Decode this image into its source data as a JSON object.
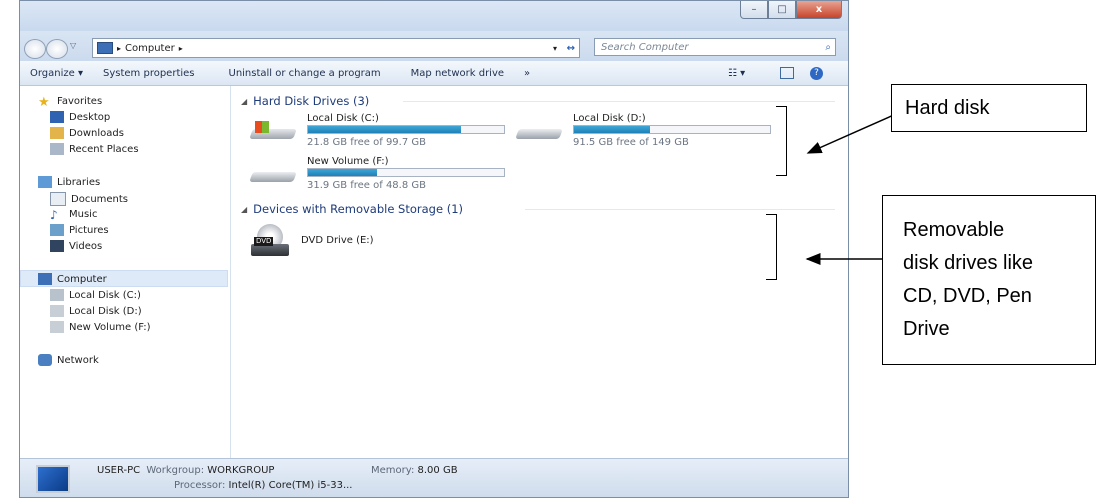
{
  "window": {
    "minimize": "–",
    "maximize": "□",
    "close": "x"
  },
  "address": {
    "path": [
      "Computer"
    ],
    "search_placeholder": "Search Computer"
  },
  "toolbar": {
    "organize": "Organize ▾",
    "system_properties": "System properties",
    "uninstall": "Uninstall or change a program",
    "map_drive": "Map network drive",
    "more": "»"
  },
  "sidebar": {
    "favorites": "Favorites",
    "desktop": "Desktop",
    "downloads": "Downloads",
    "recent": "Recent Places",
    "libraries": "Libraries",
    "documents": "Documents",
    "music": "Music",
    "pictures": "Pictures",
    "videos": "Videos",
    "computer": "Computer",
    "disk_c": "Local Disk (C:)",
    "disk_d": "Local Disk (D:)",
    "disk_f": "New Volume (F:)",
    "network": "Network"
  },
  "groups": {
    "hard_disks": "Hard Disk Drives (3)",
    "removable": "Devices with Removable Storage (1)"
  },
  "drives": [
    {
      "name": "Local Disk (C:)",
      "free": "21.8 GB free of 99.7 GB",
      "used_fraction": 0.78
    },
    {
      "name": "Local Disk (D:)",
      "free": "91.5 GB free of 149 GB",
      "used_fraction": 0.39
    },
    {
      "name": "New Volume (F:)",
      "free": "31.9 GB free of 48.8 GB",
      "used_fraction": 0.35
    }
  ],
  "dvd": {
    "name": "DVD Drive (E:)",
    "badge": "DVD"
  },
  "details": {
    "pc_name": "USER-PC",
    "workgroup_label": "Workgroup:",
    "workgroup": "WORKGROUP",
    "memory_label": "Memory:",
    "memory": "8.00 GB",
    "processor_label": "Processor:",
    "processor": "Intel(R) Core(TM) i5-33..."
  },
  "annotations": {
    "hard_disk": "Hard disk",
    "removable_lines": [
      "Removable",
      "disk drives like",
      "CD, DVD,  Pen",
      "Drive"
    ]
  }
}
